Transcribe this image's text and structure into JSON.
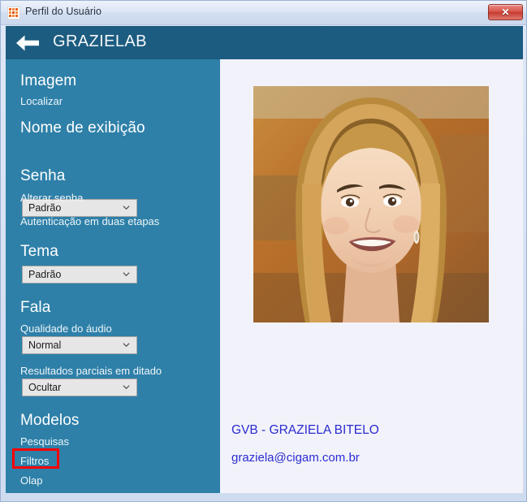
{
  "window": {
    "title": "Perfil do Usuário",
    "app_icon": "app-icon",
    "close_label": "✕"
  },
  "header": {
    "back_icon": "back-arrow-icon",
    "title": "GRAZIELAB",
    "bg_color": "#1c5c80"
  },
  "sidebar": {
    "bg_color": "#2e80a8",
    "sections": [
      {
        "heading": "Imagem",
        "links": [
          "Localizar"
        ]
      },
      {
        "heading": "Nome de exibição",
        "dropdown": {
          "value": "Padrão"
        }
      },
      {
        "heading": "Senha",
        "links": [
          "Alterar senha",
          "Autenticação em duas etapas"
        ]
      },
      {
        "heading": "Tema",
        "dropdown": {
          "value": "Padrão"
        }
      },
      {
        "heading": "Fala",
        "fields": [
          {
            "label": "Qualidade do áudio",
            "value": "Normal"
          },
          {
            "label": "Resultados parciais em ditado",
            "value": "Ocultar"
          }
        ]
      },
      {
        "heading": "Modelos",
        "links": [
          "Pesquisas",
          "Filtros",
          "Olap"
        ]
      }
    ],
    "highlight": {
      "target": "Filtros",
      "color": "#fe0000"
    }
  },
  "content": {
    "bg_color": "#f2f3fa",
    "avatar": "user-photo",
    "user_name": "GVB - GRAZIELA BITELO",
    "user_email": "graziela@cigam.com.br",
    "text_color": "#2b2bd0"
  }
}
